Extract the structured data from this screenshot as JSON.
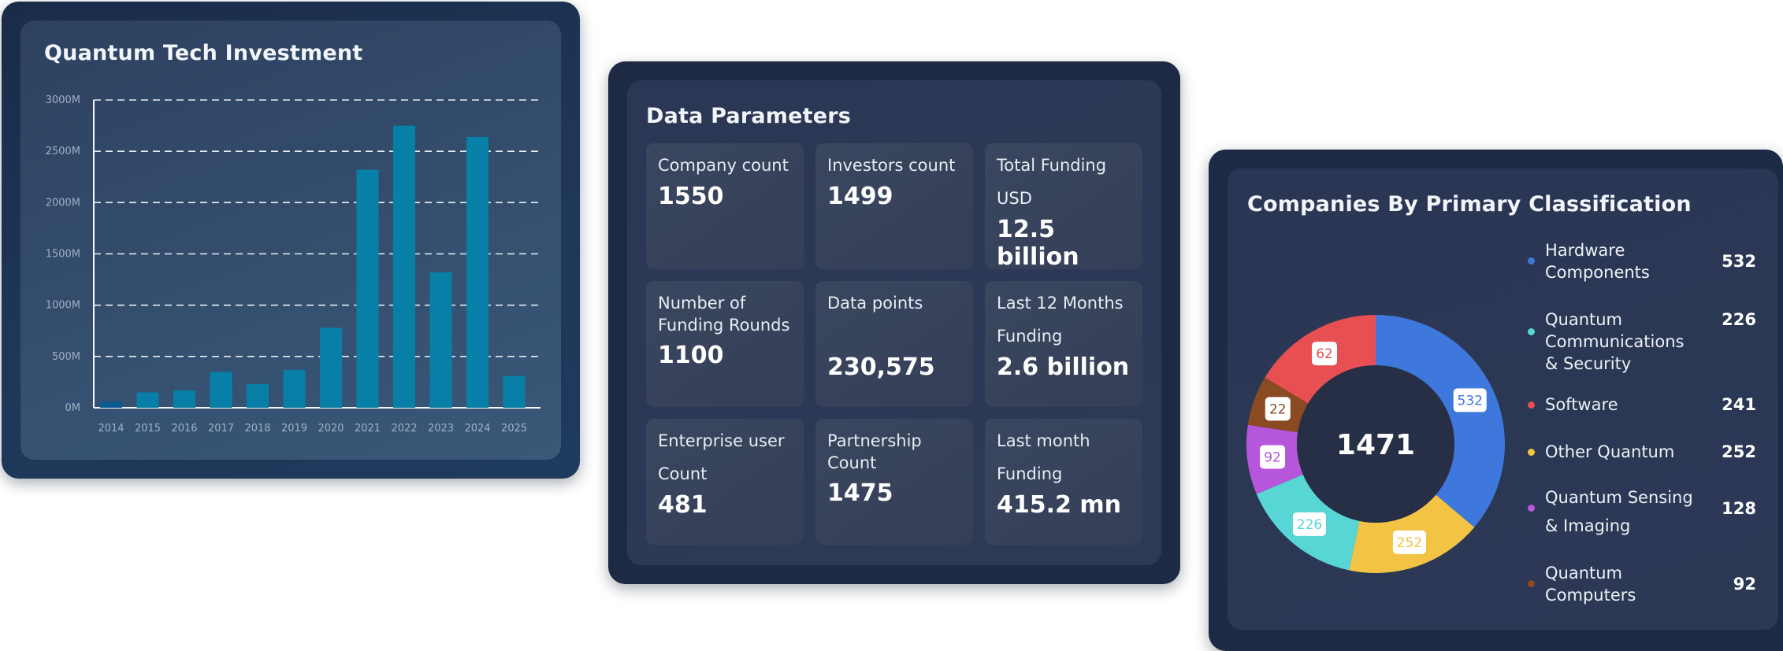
{
  "investment": {
    "title": "Quantum Tech Investment",
    "chart_data": {
      "type": "bar",
      "title": "Quantum Tech Investment",
      "categories": [
        "2014",
        "2015",
        "2016",
        "2017",
        "2018",
        "2019",
        "2020",
        "2021",
        "2022",
        "2023",
        "2024",
        "2025"
      ],
      "values": [
        60,
        150,
        170,
        350,
        230,
        370,
        780,
        2320,
        2750,
        1320,
        2640,
        310
      ],
      "ylim": [
        0,
        3000
      ],
      "yticks": [
        "0M",
        "500M",
        "1000M",
        "1500M",
        "2000M",
        "2500M",
        "3000M"
      ],
      "ytick_values": [
        0,
        500,
        1000,
        1500,
        2000,
        2500,
        3000
      ],
      "grid": "dashed horizontal",
      "colors": {
        "bar": "#087fa6",
        "first_bar": "#0c5c92"
      }
    }
  },
  "params": {
    "title": "Data Parameters",
    "tiles": [
      {
        "label": "Company count",
        "value": "1550"
      },
      {
        "label": "Investors count",
        "value": "1499"
      },
      {
        "label": "Total Funding USD",
        "value": "12.5 billion"
      },
      {
        "label": "Number of Funding Rounds",
        "value": "1100"
      },
      {
        "label": "Data points",
        "value": "230,575"
      },
      {
        "label": "Last 12 Months Funding",
        "value": "2.6 billion"
      },
      {
        "label": "Enterprise user Count",
        "value": "481"
      },
      {
        "label": "Partnership Count",
        "value": "1475"
      },
      {
        "label": "Last month Funding",
        "value": "415.2 mn"
      }
    ]
  },
  "classification": {
    "title": "Companies By Primary Classification",
    "total": "1471",
    "chart_data": {
      "type": "pie",
      "title": "Companies By Primary Classification",
      "center_label": "1471",
      "slices": [
        {
          "name": "Hardware Components",
          "value": 532,
          "color": "#3f78dc"
        },
        {
          "name": "Other Quantum",
          "value": 252,
          "color": "#f3c443"
        },
        {
          "name": "Quantum Communications & Security",
          "value": 226,
          "color": "#58d6d6"
        },
        {
          "name": "Quantum Sensing & Imaging",
          "value": 128,
          "color": "#b556db"
        },
        {
          "name": "Quantum Computers",
          "value": 92,
          "color": "#8a4b22"
        },
        {
          "name": "Software",
          "value": 241,
          "color": "#e84f52"
        }
      ],
      "slice_labels": [
        "532",
        "252",
        "226",
        "92",
        "22",
        "62"
      ]
    },
    "legend": [
      {
        "name": "Hardware Components",
        "count": "532",
        "color": "#3f78dc"
      },
      {
        "name": "Quantum Communications & Security",
        "count": "226",
        "color": "#58d6d6"
      },
      {
        "name": "Software",
        "count": "241",
        "color": "#e84f52"
      },
      {
        "name": "Other Quantum",
        "count": "252",
        "color": "#f3c443"
      },
      {
        "name": "Quantum Sensing & Imaging",
        "count": "128",
        "color": "#b556db"
      },
      {
        "name": "Quantum Computers",
        "count": "92",
        "color": "#8a4b22"
      }
    ]
  }
}
